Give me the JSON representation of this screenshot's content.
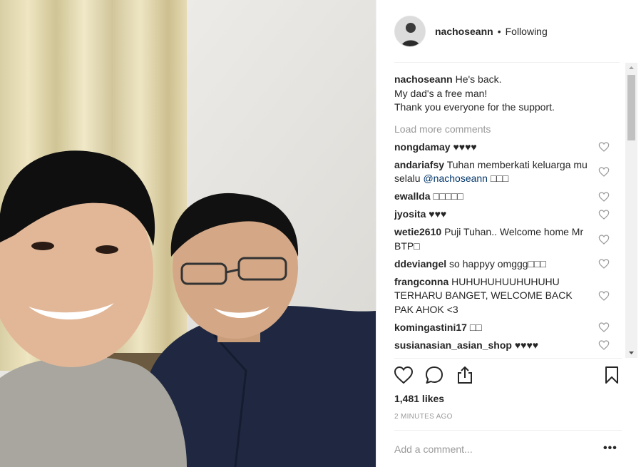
{
  "post": {
    "username": "nachoseann",
    "follow_status": "Following",
    "separator": "•",
    "caption": {
      "username": "nachoseann",
      "lines": [
        "He's back.",
        "My dad's a free man!",
        "Thank you everyone for the support."
      ]
    },
    "load_more_label": "Load more comments",
    "comments": [
      {
        "user": "nongdamay",
        "text": "♥♥♥♥"
      },
      {
        "user": "andariafsy",
        "text": "Tuhan memberkati keluarga mu selalu ",
        "mention": "@nachoseann",
        "suffix": " □□□"
      },
      {
        "user": "ewallda",
        "text": "□□□□□"
      },
      {
        "user": "jyosita",
        "text": "♥♥♥"
      },
      {
        "user": "wetie2610",
        "text": "Puji Tuhan.. Welcome home Mr BTP□"
      },
      {
        "user": "ddeviangel",
        "text": "so happyy omggg□□□"
      },
      {
        "user": "frangconna",
        "text": "HUHUHUHUUHUHUHU TERHARU BANGET, WELCOME BACK PAK AHOK <3"
      },
      {
        "user": "komingastini17",
        "text": "□□"
      },
      {
        "user": "susianasian_asian_shop",
        "text": "♥♥♥♥"
      }
    ],
    "likes": "1,481 likes",
    "time_ago": "2 MINUTES AGO",
    "add_comment_placeholder": "Add a comment...",
    "more_options": "•••"
  },
  "icons": {
    "like": "heart-outline-icon",
    "comment": "speech-bubble-icon",
    "share": "share-upload-icon",
    "save": "bookmark-icon",
    "comment_like": "small-heart-icon"
  },
  "colors": {
    "text": "#262626",
    "muted": "#999999",
    "mention": "#003569",
    "border": "#efefef"
  }
}
